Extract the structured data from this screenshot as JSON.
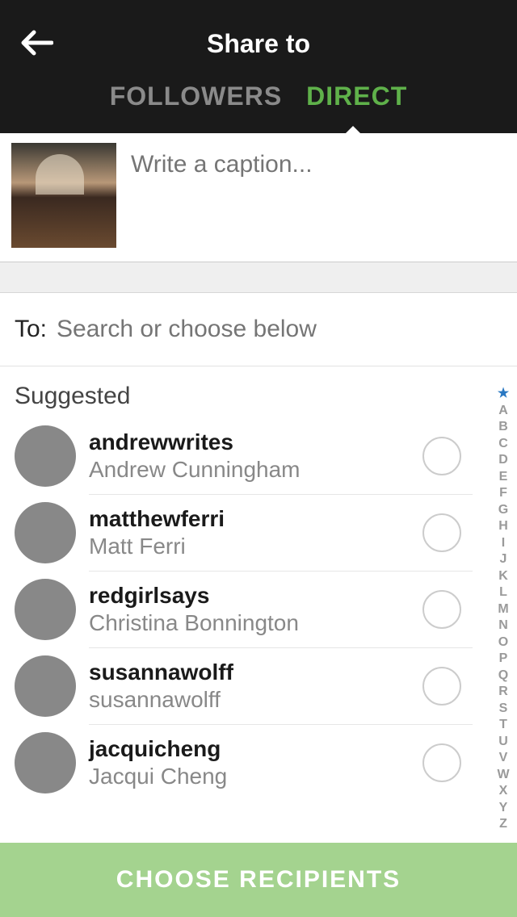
{
  "header": {
    "title": "Share to",
    "tabs": {
      "followers": "FOLLOWERS",
      "direct": "DIRECT"
    }
  },
  "caption": {
    "placeholder": "Write a caption..."
  },
  "to": {
    "label": "To:",
    "placeholder": "Search or choose below"
  },
  "suggested": {
    "label": "Suggested",
    "items": [
      {
        "username": "andrewwrites",
        "display": "Andrew Cunningham"
      },
      {
        "username": "matthewferri",
        "display": "Matt Ferri"
      },
      {
        "username": "redgirlsays",
        "display": "Christina Bonnington"
      },
      {
        "username": "susannawolff",
        "display": "susannawolff"
      },
      {
        "username": "jacquicheng",
        "display": "Jacqui Cheng"
      }
    ]
  },
  "alpha_index": [
    "A",
    "B",
    "C",
    "D",
    "E",
    "F",
    "G",
    "H",
    "I",
    "J",
    "K",
    "L",
    "M",
    "N",
    "O",
    "P",
    "Q",
    "R",
    "S",
    "T",
    "U",
    "V",
    "W",
    "X",
    "Y",
    "Z"
  ],
  "footer": {
    "choose": "CHOOSE RECIPIENTS"
  }
}
